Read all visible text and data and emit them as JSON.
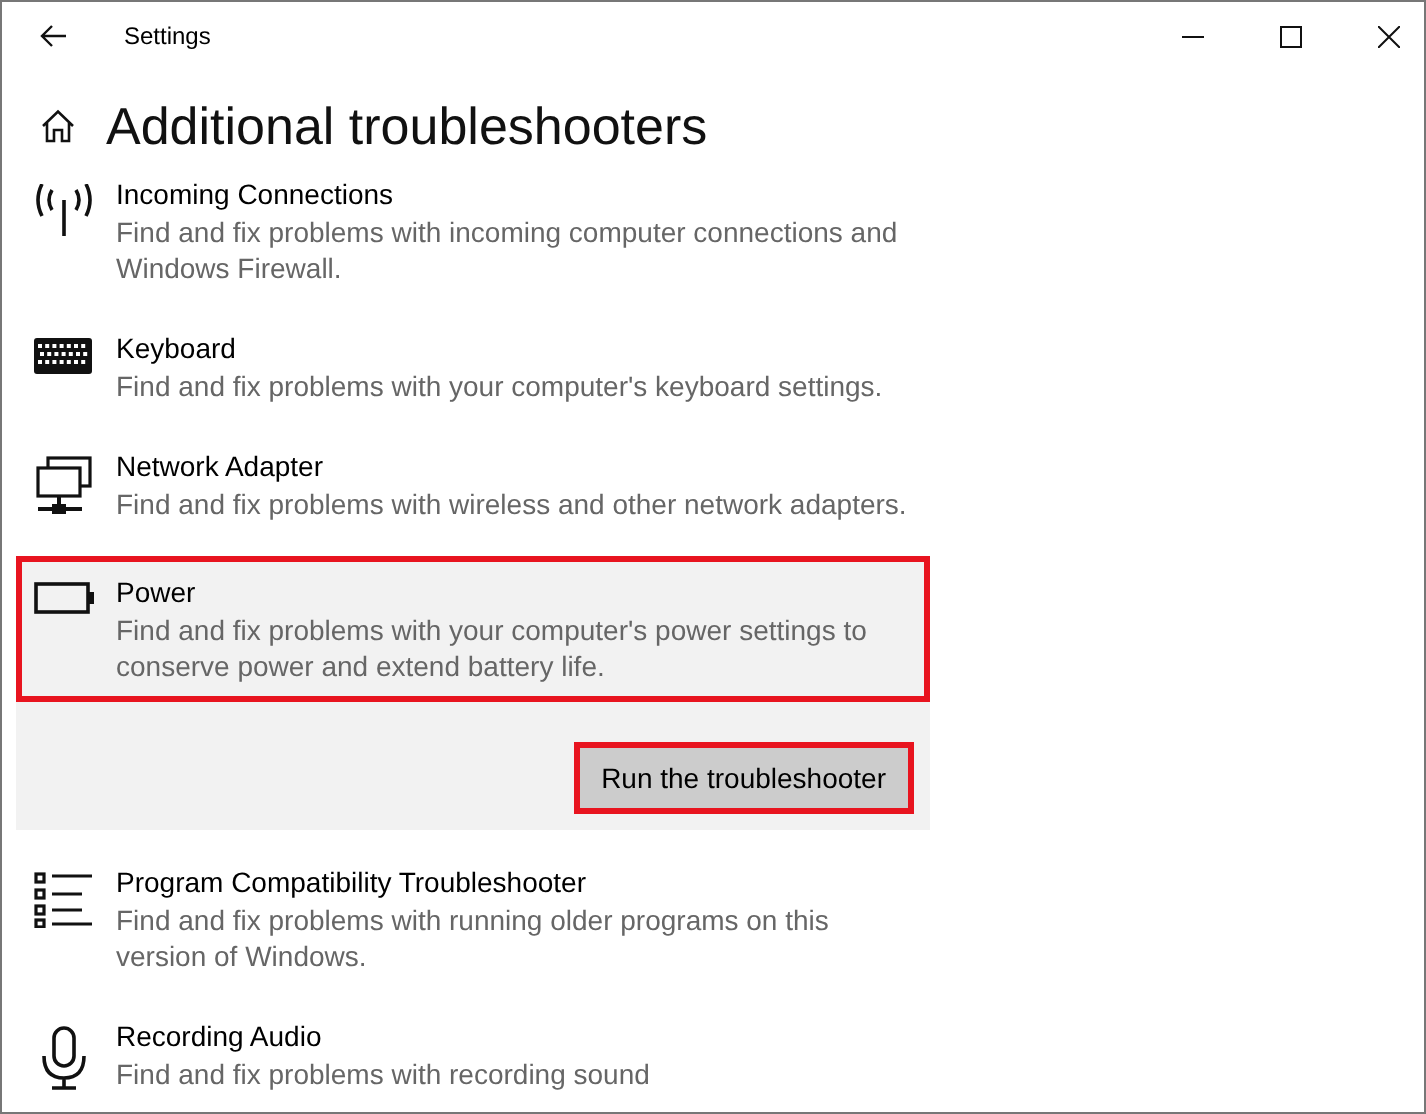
{
  "window": {
    "title": "Settings"
  },
  "page": {
    "title": "Additional troubleshooters"
  },
  "items": [
    {
      "kind": "antenna",
      "title": "Incoming Connections",
      "description": "Find and fix problems with incoming computer connections and Windows Firewall.",
      "selected": false,
      "highlighted": false
    },
    {
      "kind": "keyboard",
      "title": "Keyboard",
      "description": "Find and fix problems with your computer's keyboard settings.",
      "selected": false,
      "highlighted": false
    },
    {
      "kind": "network",
      "title": "Network Adapter",
      "description": "Find and fix problems with wireless and other network adapters.",
      "selected": false,
      "highlighted": false
    },
    {
      "kind": "battery",
      "title": "Power",
      "description": "Find and fix problems with your computer's power settings to conserve power and extend battery life.",
      "selected": true,
      "highlighted": true
    },
    {
      "kind": "list",
      "title": "Program Compatibility Troubleshooter",
      "description": "Find and fix problems with running older programs on this version of Windows.",
      "selected": false,
      "highlighted": false
    },
    {
      "kind": "microphone",
      "title": "Recording Audio",
      "description": "Find and fix problems with recording sound",
      "selected": false,
      "highlighted": false
    }
  ],
  "run_button": {
    "label": "Run the troubleshooter",
    "highlighted": true
  }
}
